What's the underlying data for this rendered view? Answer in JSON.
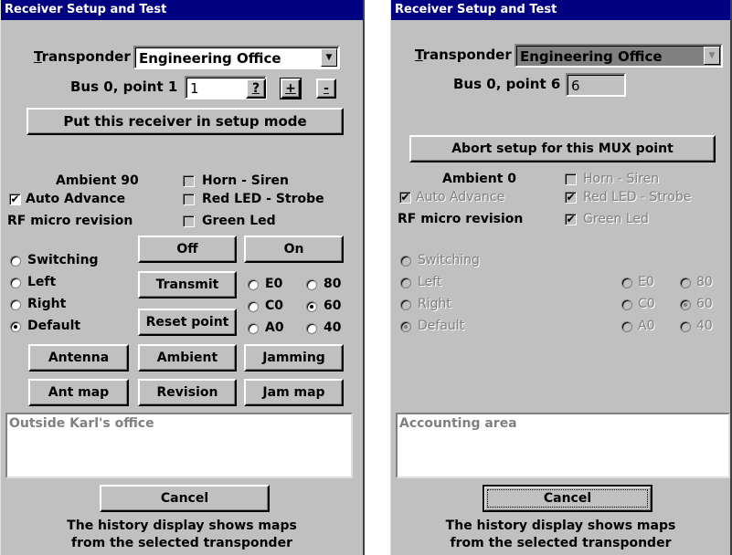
{
  "left_window": {
    "title": "Receiver Setup and Test",
    "transponder_label": "Transponder",
    "transponder_value": "Engineering Office",
    "bus_label": "Bus 0, point 1",
    "bus_value": "1",
    "help_btn": "?",
    "plus_btn": "+",
    "minus_btn": "-",
    "setup_btn": "Put this receiver in setup mode",
    "ambient_label": "Ambient 90",
    "auto_advance_label": "Auto Advance",
    "auto_advance_checked": true,
    "rf_label": "RF micro revision",
    "horn_label": "Horn - Siren",
    "horn_checked": false,
    "red_label": "Red LED - Strobe",
    "red_checked": false,
    "green_label": "Green Led",
    "green_checked": false,
    "radios": [
      "Switching",
      "Left",
      "Right",
      "Default"
    ],
    "radio_selected": "Default",
    "off_btn": "Off",
    "on_btn": "On",
    "transmit_btn": "Transmit",
    "reset_btn": "Reset point",
    "codes": [
      "E0",
      "80",
      "C0",
      "60",
      "A0",
      "40"
    ],
    "code_selected": "60",
    "antenna_btn": "Antenna",
    "ambient_btn": "Ambient",
    "jamming_btn": "Jamming",
    "antmap_btn": "Ant map",
    "revision_btn": "Revision",
    "jammap_btn": "Jam map",
    "memo_text": "Outside Karl's office",
    "cancel_btn": "Cancel",
    "footer_line1": "The history display shows maps",
    "footer_line2": "from the selected transponder"
  },
  "right_window": {
    "title": "Receiver Setup and Test",
    "transponder_label": "Transponder",
    "transponder_value": "Engineering Office",
    "bus_label": "Bus 0, point 6",
    "bus_value": "6",
    "abort_btn": "Abort setup for this MUX point",
    "ambient_label": "Ambient 0",
    "auto_advance_label": "Auto Advance",
    "auto_advance_checked": true,
    "rf_label": "RF micro revision",
    "horn_label": "Horn - Siren",
    "horn_checked": false,
    "red_label": "Red LED - Strobe",
    "red_checked": true,
    "green_label": "Green Led",
    "green_checked": true,
    "radios": [
      "Switching",
      "Left",
      "Right",
      "Default"
    ],
    "radio_selected": "Default",
    "codes": [
      "E0",
      "80",
      "C0",
      "60",
      "A0",
      "40"
    ],
    "code_selected": "60",
    "memo_text": "Accounting area",
    "cancel_btn": "Cancel",
    "footer_line1": "The history display shows maps",
    "footer_line2": "from the selected transponder"
  },
  "icons": {
    "check": "check-icon",
    "combo_arrow": "chevron-down-icon"
  },
  "colors": {
    "titlebar": "#000080",
    "face": "#c0c0c0",
    "disabled_text": "#808080"
  }
}
